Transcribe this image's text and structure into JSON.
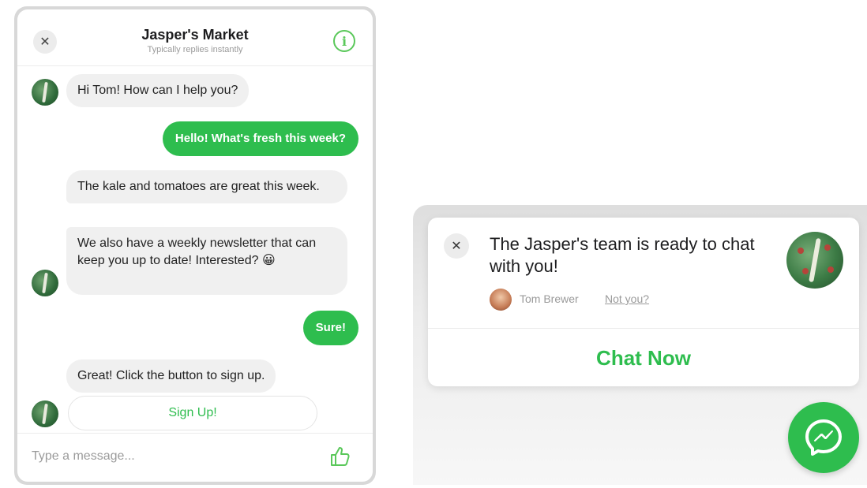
{
  "chat": {
    "title": "Jasper's Market",
    "subtitle": "Typically replies instantly",
    "messages": [
      {
        "from": "bot",
        "text": "Hi Tom! How can I help you?"
      },
      {
        "from": "me",
        "text": "Hello! What's fresh this week?"
      },
      {
        "from": "bot",
        "text": "The kale and tomatoes are great this week."
      },
      {
        "from": "bot",
        "text": "We also have a weekly newsletter that can keep you up to date! Interested? 😀"
      },
      {
        "from": "me",
        "text": "Sure!"
      },
      {
        "from": "bot",
        "text": "Great! Click the button to sign up."
      }
    ],
    "signup_label": "Sign Up!",
    "composer_placeholder": "Type a message..."
  },
  "notification": {
    "title": "The Jasper's team is ready to chat with you!",
    "user_name": "Tom Brewer",
    "not_you": "Not you?",
    "chat_now": "Chat Now"
  },
  "icons": {
    "close": "close-icon",
    "info": "info-icon",
    "like": "thumbs-up-icon",
    "messenger": "messenger-icon"
  },
  "colors": {
    "accent_green": "#2ebd4e",
    "bubble_gray": "#f0f0f0"
  }
}
